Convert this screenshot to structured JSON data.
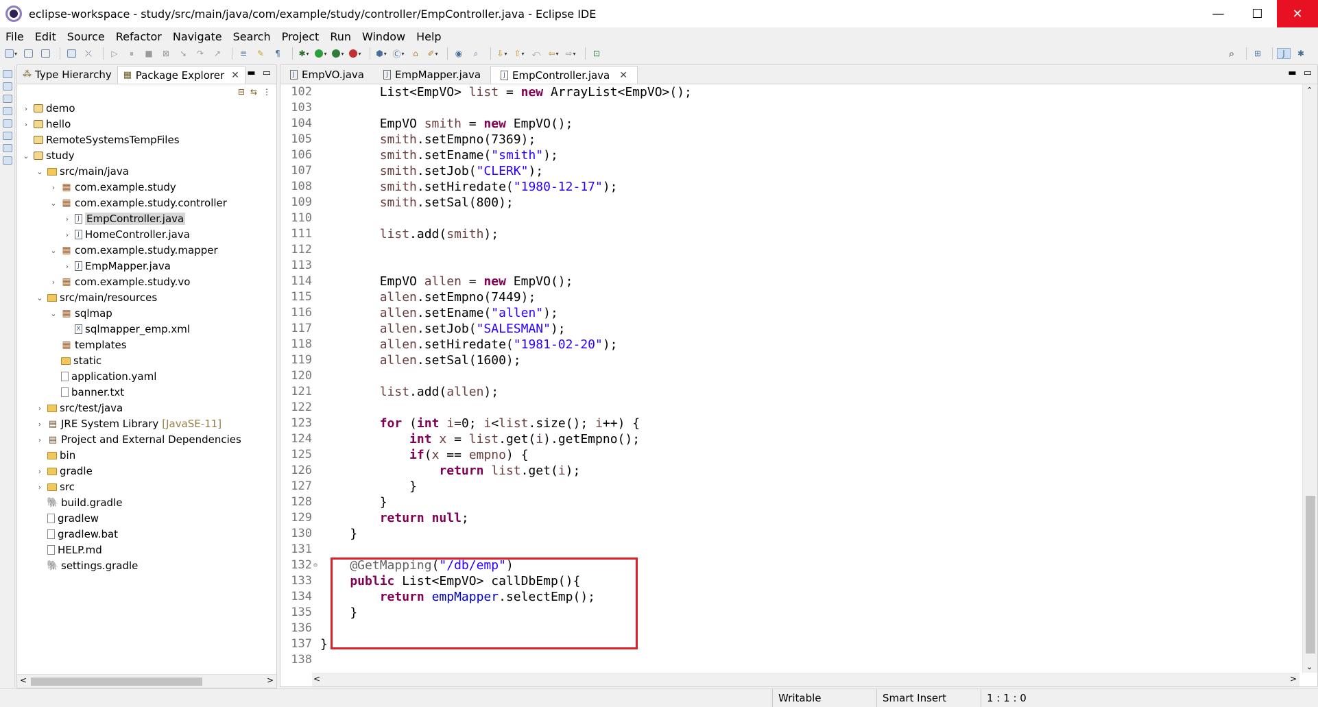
{
  "window": {
    "title": "eclipse-workspace - study/src/main/java/com/example/study/controller/EmpController.java - Eclipse IDE",
    "minimize": "—",
    "maximize": "☐",
    "close": "✕"
  },
  "menu": [
    "File",
    "Edit",
    "Source",
    "Refactor",
    "Navigate",
    "Search",
    "Project",
    "Run",
    "Window",
    "Help"
  ],
  "explorer": {
    "tabs": [
      {
        "label": "Type Hierarchy",
        "active": false
      },
      {
        "label": "Package Explorer",
        "active": true,
        "close": "✕"
      }
    ],
    "tree": [
      {
        "label": "demo",
        "depth": 0,
        "toggle": ">",
        "icon": "project"
      },
      {
        "label": "hello",
        "depth": 0,
        "toggle": ">",
        "icon": "project"
      },
      {
        "label": "RemoteSystemsTempFiles",
        "depth": 0,
        "toggle": "",
        "icon": "project"
      },
      {
        "label": "study",
        "depth": 0,
        "toggle": "v",
        "icon": "project"
      },
      {
        "label": "src/main/java",
        "depth": 1,
        "toggle": "v",
        "icon": "src"
      },
      {
        "label": "com.example.study",
        "depth": 2,
        "toggle": ">",
        "icon": "package"
      },
      {
        "label": "com.example.study.controller",
        "depth": 2,
        "toggle": "v",
        "icon": "package"
      },
      {
        "label": "EmpController.java",
        "depth": 3,
        "toggle": ">",
        "icon": "java",
        "selected": true
      },
      {
        "label": "HomeController.java",
        "depth": 3,
        "toggle": ">",
        "icon": "java"
      },
      {
        "label": "com.example.study.mapper",
        "depth": 2,
        "toggle": "v",
        "icon": "package"
      },
      {
        "label": "EmpMapper.java",
        "depth": 3,
        "toggle": ">",
        "icon": "java"
      },
      {
        "label": "com.example.study.vo",
        "depth": 2,
        "toggle": ">",
        "icon": "package"
      },
      {
        "label": "src/main/resources",
        "depth": 1,
        "toggle": "v",
        "icon": "src"
      },
      {
        "label": "sqlmap",
        "depth": 2,
        "toggle": "v",
        "icon": "package"
      },
      {
        "label": "sqlmapper_emp.xml",
        "depth": 3,
        "toggle": "",
        "icon": "xml"
      },
      {
        "label": "templates",
        "depth": 2,
        "toggle": "",
        "icon": "package"
      },
      {
        "label": "static",
        "depth": 2,
        "toggle": "",
        "icon": "folder"
      },
      {
        "label": "application.yaml",
        "depth": 2,
        "toggle": "",
        "icon": "file"
      },
      {
        "label": "banner.txt",
        "depth": 2,
        "toggle": "",
        "icon": "file"
      },
      {
        "label": "src/test/java",
        "depth": 1,
        "toggle": ">",
        "icon": "src"
      },
      {
        "label": "JRE System Library",
        "extra": "[JavaSE-11]",
        "depth": 1,
        "toggle": ">",
        "icon": "library"
      },
      {
        "label": "Project and External Dependencies",
        "depth": 1,
        "toggle": ">",
        "icon": "library"
      },
      {
        "label": "bin",
        "depth": 1,
        "toggle": "",
        "icon": "folder"
      },
      {
        "label": "gradle",
        "depth": 1,
        "toggle": ">",
        "icon": "folder"
      },
      {
        "label": "src",
        "depth": 1,
        "toggle": ">",
        "icon": "folder"
      },
      {
        "label": "build.gradle",
        "depth": 1,
        "toggle": "",
        "icon": "gradle"
      },
      {
        "label": "gradlew",
        "depth": 1,
        "toggle": "",
        "icon": "file"
      },
      {
        "label": "gradlew.bat",
        "depth": 1,
        "toggle": "",
        "icon": "file"
      },
      {
        "label": "HELP.md",
        "depth": 1,
        "toggle": "",
        "icon": "file"
      },
      {
        "label": "settings.gradle",
        "depth": 1,
        "toggle": "",
        "icon": "gradle"
      }
    ]
  },
  "editor": {
    "tabs": [
      {
        "label": "EmpVO.java",
        "active": false
      },
      {
        "label": "EmpMapper.java",
        "active": false
      },
      {
        "label": "EmpController.java",
        "active": true,
        "close": "✕"
      }
    ],
    "lines": [
      {
        "n": "102",
        "t": [
          [
            "",
            "        List<EmpVO> "
          ],
          [
            "var",
            "list"
          ],
          [
            "",
            " = "
          ],
          [
            "kw",
            "new"
          ],
          [
            "",
            " ArrayList<EmpVO>();"
          ]
        ]
      },
      {
        "n": "103",
        "t": []
      },
      {
        "n": "104",
        "t": [
          [
            "",
            "        EmpVO "
          ],
          [
            "var",
            "smith"
          ],
          [
            "",
            " = "
          ],
          [
            "kw",
            "new"
          ],
          [
            "",
            " EmpVO();"
          ]
        ]
      },
      {
        "n": "105",
        "t": [
          [
            "var",
            "        smith"
          ],
          [
            "",
            ".setEmpno(7369);"
          ]
        ]
      },
      {
        "n": "106",
        "t": [
          [
            "var",
            "        smith"
          ],
          [
            "",
            ".setEname("
          ],
          [
            "str",
            "\"smith\""
          ],
          [
            "",
            ");"
          ]
        ]
      },
      {
        "n": "107",
        "t": [
          [
            "var",
            "        smith"
          ],
          [
            "",
            ".setJob("
          ],
          [
            "str",
            "\"CLERK\""
          ],
          [
            "",
            ");"
          ]
        ]
      },
      {
        "n": "108",
        "t": [
          [
            "var",
            "        smith"
          ],
          [
            "",
            ".setHiredate("
          ],
          [
            "str",
            "\"1980-12-17\""
          ],
          [
            "",
            ");"
          ]
        ]
      },
      {
        "n": "109",
        "t": [
          [
            "var",
            "        smith"
          ],
          [
            "",
            ".setSal(800);"
          ]
        ]
      },
      {
        "n": "110",
        "t": []
      },
      {
        "n": "111",
        "t": [
          [
            "var",
            "        list"
          ],
          [
            "",
            ".add("
          ],
          [
            "var",
            "smith"
          ],
          [
            "",
            ");"
          ]
        ]
      },
      {
        "n": "112",
        "t": []
      },
      {
        "n": "113",
        "t": []
      },
      {
        "n": "114",
        "t": [
          [
            "",
            "        EmpVO "
          ],
          [
            "var",
            "allen"
          ],
          [
            "",
            " = "
          ],
          [
            "kw",
            "new"
          ],
          [
            "",
            " EmpVO();"
          ]
        ]
      },
      {
        "n": "115",
        "t": [
          [
            "var",
            "        allen"
          ],
          [
            "",
            ".setEmpno(7449);"
          ]
        ]
      },
      {
        "n": "116",
        "t": [
          [
            "var",
            "        allen"
          ],
          [
            "",
            ".setEname("
          ],
          [
            "str",
            "\"allen\""
          ],
          [
            "",
            ");"
          ]
        ]
      },
      {
        "n": "117",
        "t": [
          [
            "var",
            "        allen"
          ],
          [
            "",
            ".setJob("
          ],
          [
            "str",
            "\"SALESMAN\""
          ],
          [
            "",
            ");"
          ]
        ]
      },
      {
        "n": "118",
        "t": [
          [
            "var",
            "        allen"
          ],
          [
            "",
            ".setHiredate("
          ],
          [
            "str",
            "\"1981-02-20\""
          ],
          [
            "",
            ");"
          ]
        ]
      },
      {
        "n": "119",
        "t": [
          [
            "var",
            "        allen"
          ],
          [
            "",
            ".setSal(1600);"
          ]
        ]
      },
      {
        "n": "120",
        "t": []
      },
      {
        "n": "121",
        "t": [
          [
            "var",
            "        list"
          ],
          [
            "",
            ".add("
          ],
          [
            "var",
            "allen"
          ],
          [
            "",
            ");"
          ]
        ]
      },
      {
        "n": "122",
        "t": []
      },
      {
        "n": "123",
        "t": [
          [
            "kw",
            "        for"
          ],
          [
            "",
            " ("
          ],
          [
            "kw",
            "int"
          ],
          [
            "",
            " "
          ],
          [
            "var",
            "i"
          ],
          [
            "",
            "=0; "
          ],
          [
            "var",
            "i"
          ],
          [
            "",
            "<"
          ],
          [
            "var",
            "list"
          ],
          [
            "",
            ".size(); "
          ],
          [
            "var",
            "i"
          ],
          [
            "",
            "++) {"
          ]
        ]
      },
      {
        "n": "124",
        "t": [
          [
            "kw",
            "            int"
          ],
          [
            "",
            " "
          ],
          [
            "var",
            "x"
          ],
          [
            "",
            " = "
          ],
          [
            "var",
            "list"
          ],
          [
            "",
            ".get("
          ],
          [
            "var",
            "i"
          ],
          [
            "",
            ").getEmpno();"
          ]
        ]
      },
      {
        "n": "125",
        "t": [
          [
            "kw",
            "            if"
          ],
          [
            "",
            "("
          ],
          [
            "var",
            "x"
          ],
          [
            "",
            " == "
          ],
          [
            "var",
            "empno"
          ],
          [
            "",
            ") {"
          ]
        ]
      },
      {
        "n": "126",
        "t": [
          [
            "kw",
            "                return"
          ],
          [
            "",
            " "
          ],
          [
            "var",
            "list"
          ],
          [
            "",
            ".get("
          ],
          [
            "var",
            "i"
          ],
          [
            "",
            ");"
          ]
        ]
      },
      {
        "n": "127",
        "t": [
          [
            "",
            "            }"
          ]
        ]
      },
      {
        "n": "128",
        "t": [
          [
            "",
            "        }"
          ]
        ]
      },
      {
        "n": "129",
        "t": [
          [
            "kw",
            "        return"
          ],
          [
            "",
            " "
          ],
          [
            "kw",
            "null"
          ],
          [
            "",
            ";"
          ]
        ]
      },
      {
        "n": "130",
        "t": [
          [
            "",
            "    }"
          ]
        ]
      },
      {
        "n": "131",
        "t": []
      },
      {
        "n": "132",
        "fold": "⊖",
        "t": [
          [
            "ann",
            "    @GetMapping"
          ],
          [
            "",
            "("
          ],
          [
            "str",
            "\"/db/emp\""
          ],
          [
            "",
            ")"
          ]
        ]
      },
      {
        "n": "133",
        "t": [
          [
            "kw",
            "    public"
          ],
          [
            "",
            " List<EmpVO> callDbEmp(){"
          ]
        ]
      },
      {
        "n": "134",
        "t": [
          [
            "kw",
            "        return"
          ],
          [
            "",
            " "
          ],
          [
            "fld",
            "empMapper"
          ],
          [
            "",
            ".selectEmp();"
          ]
        ]
      },
      {
        "n": "135",
        "t": [
          [
            "",
            "    }"
          ]
        ]
      },
      {
        "n": "136",
        "t": []
      },
      {
        "n": "137",
        "t": [
          [
            "",
            "}"
          ]
        ]
      },
      {
        "n": "138",
        "t": []
      }
    ]
  },
  "status": {
    "writable": "Writable",
    "insert_mode": "Smart Insert",
    "position": "1 : 1 : 0"
  },
  "colors": {
    "keyword": "#7f0055",
    "string": "#2a00ff",
    "field": "#0000c0",
    "local_var": "#6a3e3e",
    "annotation": "#646464",
    "highlight_box": "#e01e2a",
    "close_button": "#e81123"
  }
}
